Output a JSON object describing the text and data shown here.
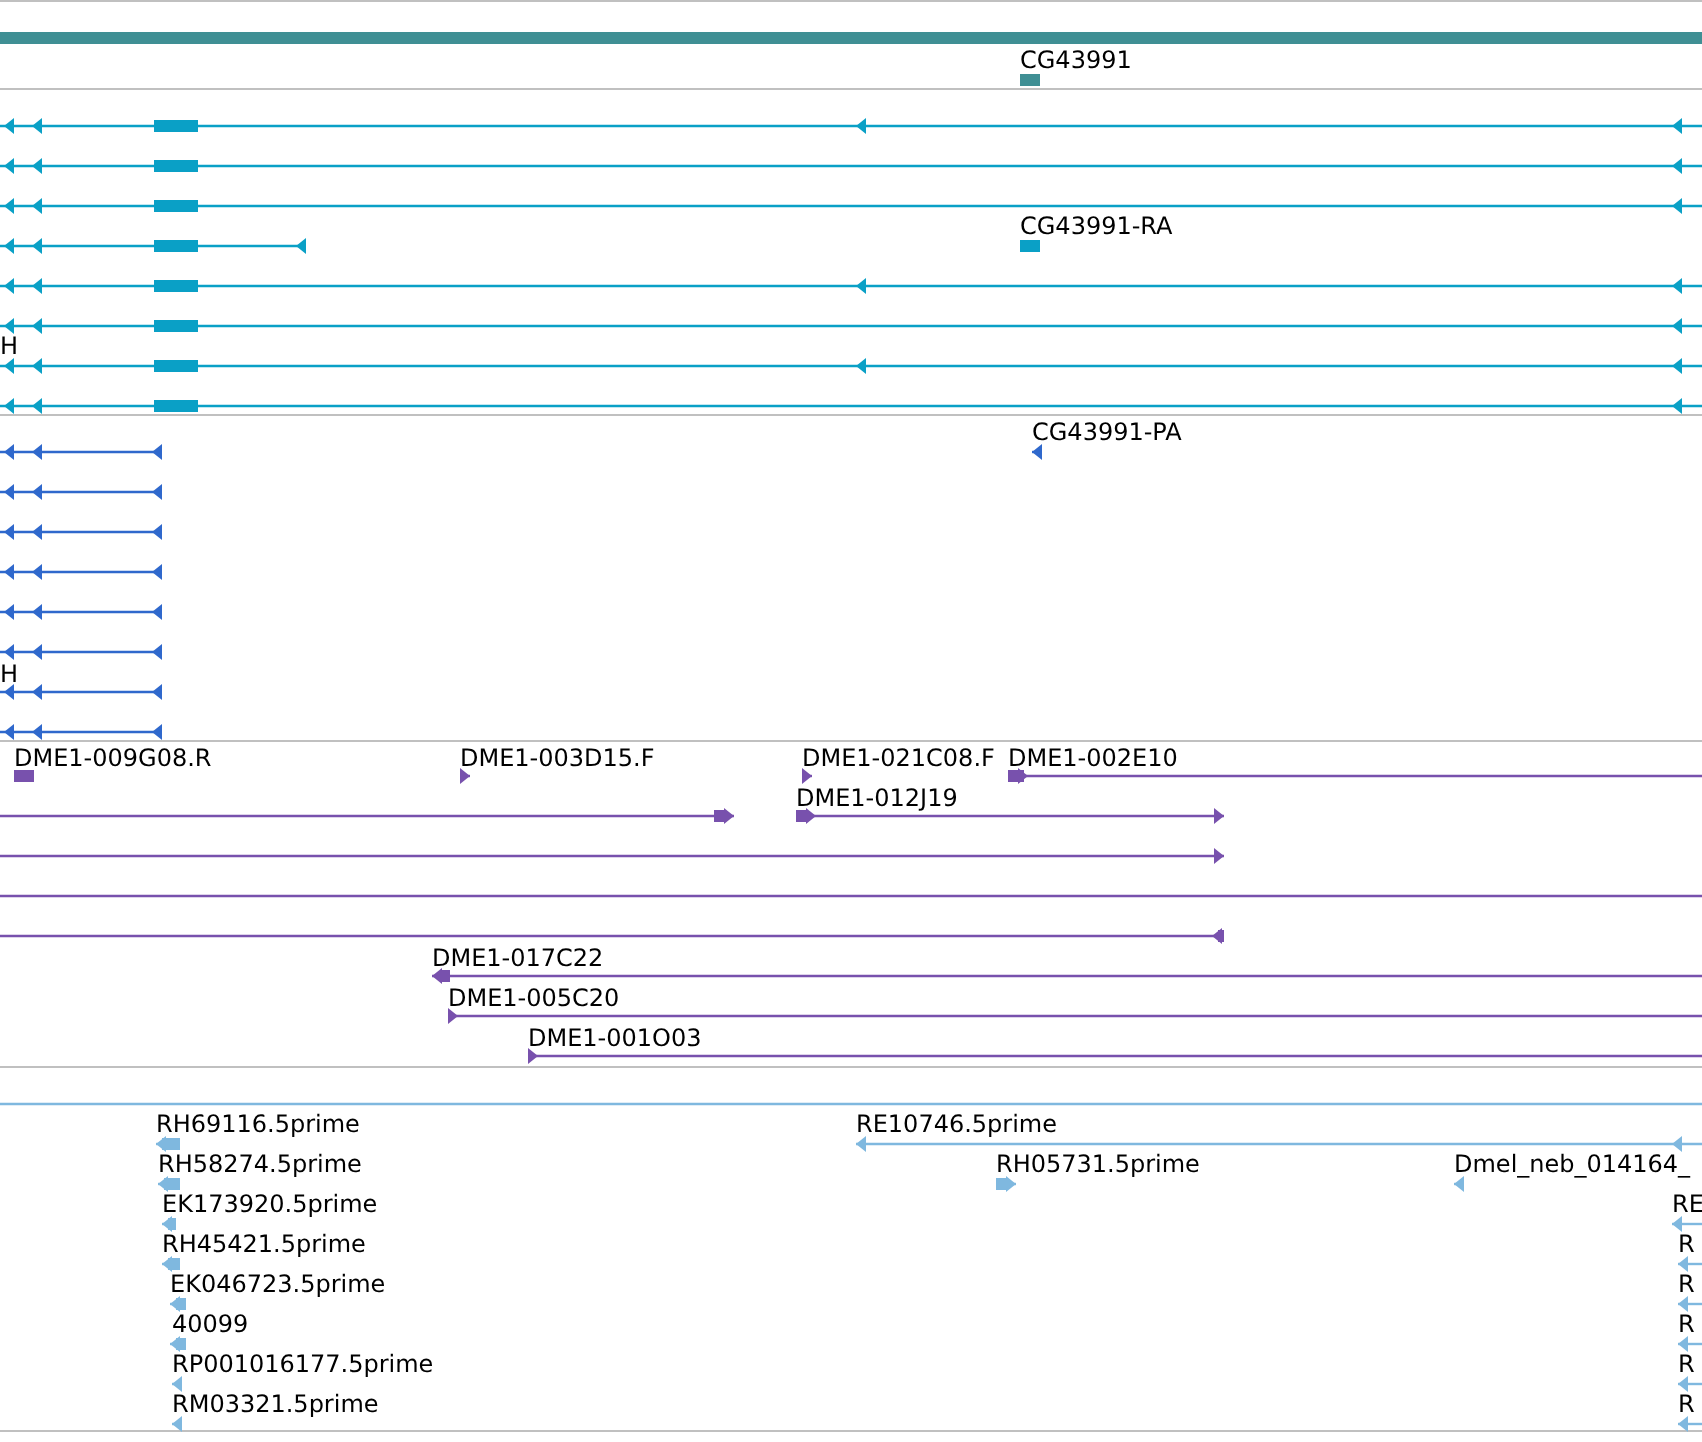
{
  "tracks": [
    {
      "kind": "gene",
      "features": [
        {
          "label": "CG43991"
        }
      ]
    },
    {
      "kind": "transcript",
      "features": [
        {
          "label": "CG43991-RA"
        },
        {
          "label": "H"
        }
      ]
    },
    {
      "kind": "protein",
      "features": [
        {
          "label": "CG43991-PA"
        },
        {
          "label": "H"
        }
      ]
    },
    {
      "kind": "clone",
      "features": [
        {
          "label": "DME1-009G08.R"
        },
        {
          "label": "DME1-003D15.F"
        },
        {
          "label": "DME1-021C08.F"
        },
        {
          "label": "DME1-002E10"
        },
        {
          "label": "DME1-012J19"
        },
        {
          "label": "DME1-017C22"
        },
        {
          "label": "DME1-005C20"
        },
        {
          "label": "DME1-001O03"
        }
      ]
    },
    {
      "kind": "est",
      "features": [
        {
          "label": "RH69116.5prime"
        },
        {
          "label": "RH58274.5prime"
        },
        {
          "label": "EK173920.5prime"
        },
        {
          "label": "RH45421.5prime"
        },
        {
          "label": "EK046723.5prime"
        },
        {
          "label": "40099"
        },
        {
          "label": "RP001016177.5prime"
        },
        {
          "label": "RM03321.5prime"
        },
        {
          "label": "RE10746.5prime"
        },
        {
          "label": "RH05731.5prime"
        },
        {
          "label": "Dmel_neb_014164_"
        },
        {
          "label": "RE"
        },
        {
          "label": "R"
        },
        {
          "label": "R"
        },
        {
          "label": "R"
        },
        {
          "label": "R"
        },
        {
          "label": "R"
        }
      ]
    }
  ]
}
